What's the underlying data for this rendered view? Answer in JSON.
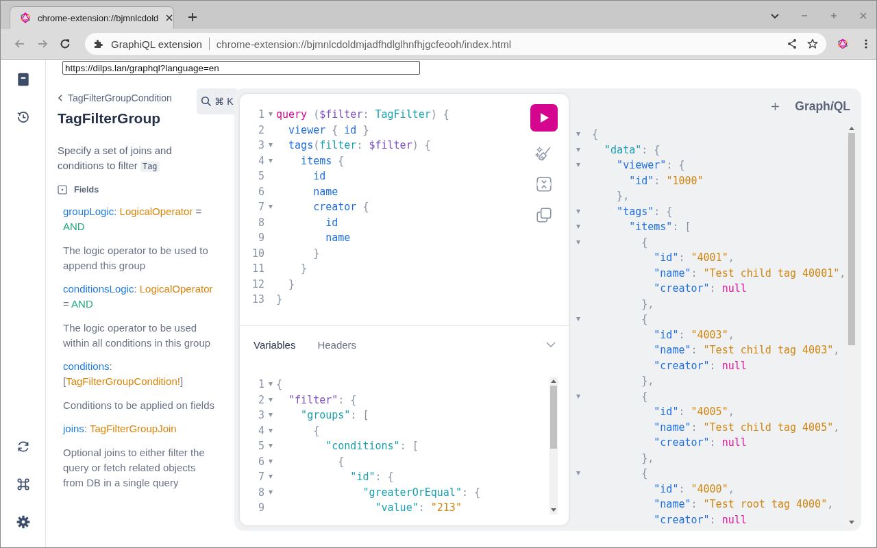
{
  "browser": {
    "tab": {
      "title": "chrome-extension://bjmnlcdold",
      "selected": true
    },
    "omnibox": {
      "site": "GraphiQL extension",
      "url": "chrome-extension://bjmnlcdoldmjadfhdlglhnfhjgcfeooh/index.html"
    }
  },
  "endpoint": {
    "value": "https://dilps.lan/graphql?language=en"
  },
  "search_button": {
    "label": "⌘ K"
  },
  "docs": {
    "breadcrumb": "TagFilterGroupCondition",
    "title": "TagFilterGroup",
    "description": "Specify a set of joins and conditions to filter",
    "description_code": "Tag",
    "section": "Fields",
    "fields": [
      {
        "signature": [
          {
            "text": "groupLogic",
            "kind": "name"
          },
          {
            "text": ": ",
            "kind": "punc"
          },
          {
            "text": "LogicalOperator",
            "kind": "type"
          },
          {
            "text": " = ",
            "kind": "punc"
          },
          {
            "text": "AND",
            "kind": "default"
          }
        ],
        "description": "The logic operator to be used to append this group"
      },
      {
        "signature": [
          {
            "text": "conditionsLogic",
            "kind": "name"
          },
          {
            "text": ": ",
            "kind": "punc"
          },
          {
            "text": "LogicalOperator",
            "kind": "type"
          },
          {
            "text": " = ",
            "kind": "punc"
          },
          {
            "text": "AND",
            "kind": "default"
          }
        ],
        "description": "The logic operator to be used within all conditions in this group"
      },
      {
        "signature": [
          {
            "text": "conditions",
            "kind": "name"
          },
          {
            "text": ": [",
            "kind": "punc"
          },
          {
            "text": "TagFilterGroupCondition!",
            "kind": "type"
          },
          {
            "text": "]",
            "kind": "punc"
          }
        ],
        "description": "Conditions to be applied on fields"
      },
      {
        "signature": [
          {
            "text": "joins",
            "kind": "name"
          },
          {
            "text": ": ",
            "kind": "punc"
          },
          {
            "text": "TagFilterGroupJoin",
            "kind": "type"
          }
        ],
        "description": "Optional joins to either filter the query or fetch related objects from DB in a single query"
      }
    ]
  },
  "editor": {
    "lines": [
      {
        "n": "1",
        "fold": true,
        "tokens": [
          {
            "text": "query",
            "kind": "kw"
          },
          {
            "text": " (",
            "kind": "punc"
          },
          {
            "text": "$filter",
            "kind": "var"
          },
          {
            "text": ": ",
            "kind": "punc"
          },
          {
            "text": "TagFilter",
            "kind": "type"
          },
          {
            "text": ") {",
            "kind": "punc"
          }
        ]
      },
      {
        "n": "2",
        "fold": false,
        "tokens": [
          {
            "text": "  viewer",
            "kind": "field"
          },
          {
            "text": " { ",
            "kind": "punc"
          },
          {
            "text": "id",
            "kind": "field"
          },
          {
            "text": " }",
            "kind": "punc"
          }
        ]
      },
      {
        "n": "3",
        "fold": true,
        "tokens": [
          {
            "text": "  tags",
            "kind": "field"
          },
          {
            "text": "(",
            "kind": "punc"
          },
          {
            "text": "filter",
            "kind": "type"
          },
          {
            "text": ": ",
            "kind": "punc"
          },
          {
            "text": "$filter",
            "kind": "var"
          },
          {
            "text": ") {",
            "kind": "punc"
          }
        ]
      },
      {
        "n": "4",
        "fold": true,
        "tokens": [
          {
            "text": "    items",
            "kind": "field"
          },
          {
            "text": " {",
            "kind": "punc"
          }
        ]
      },
      {
        "n": "5",
        "fold": false,
        "tokens": [
          {
            "text": "      id",
            "kind": "field"
          }
        ]
      },
      {
        "n": "6",
        "fold": false,
        "tokens": [
          {
            "text": "      name",
            "kind": "field"
          }
        ]
      },
      {
        "n": "7",
        "fold": true,
        "tokens": [
          {
            "text": "      creator",
            "kind": "field"
          },
          {
            "text": " {",
            "kind": "punc"
          }
        ]
      },
      {
        "n": "8",
        "fold": false,
        "tokens": [
          {
            "text": "        id",
            "kind": "field"
          }
        ]
      },
      {
        "n": "9",
        "fold": false,
        "tokens": [
          {
            "text": "        name",
            "kind": "field"
          }
        ]
      },
      {
        "n": "10",
        "fold": false,
        "tokens": [
          {
            "text": "      }",
            "kind": "punc"
          }
        ]
      },
      {
        "n": "11",
        "fold": false,
        "tokens": [
          {
            "text": "    }",
            "kind": "punc"
          }
        ]
      },
      {
        "n": "12",
        "fold": false,
        "tokens": [
          {
            "text": "  }",
            "kind": "punc"
          }
        ]
      },
      {
        "n": "13",
        "fold": false,
        "tokens": [
          {
            "text": "}",
            "kind": "punc"
          }
        ]
      }
    ]
  },
  "tool_tabs": [
    {
      "label": "Variables",
      "selected": true
    },
    {
      "label": "Headers",
      "selected": false
    }
  ],
  "variables": {
    "lines": [
      {
        "n": "1",
        "fold": true,
        "tokens": [
          {
            "text": "{",
            "kind": "punc"
          }
        ]
      },
      {
        "n": "2",
        "fold": true,
        "tokens": [
          {
            "text": "  \"filter\"",
            "kind": "var"
          },
          {
            "text": ": {",
            "kind": "punc"
          }
        ]
      },
      {
        "n": "3",
        "fold": true,
        "tokens": [
          {
            "text": "    \"groups\"",
            "kind": "type"
          },
          {
            "text": ": [",
            "kind": "punc"
          }
        ]
      },
      {
        "n": "4",
        "fold": true,
        "tokens": [
          {
            "text": "      {",
            "kind": "punc"
          }
        ]
      },
      {
        "n": "5",
        "fold": true,
        "tokens": [
          {
            "text": "        \"conditions\"",
            "kind": "type"
          },
          {
            "text": ": [",
            "kind": "punc"
          }
        ]
      },
      {
        "n": "6",
        "fold": true,
        "tokens": [
          {
            "text": "          {",
            "kind": "punc"
          }
        ]
      },
      {
        "n": "7",
        "fold": true,
        "tokens": [
          {
            "text": "            \"id\"",
            "kind": "type"
          },
          {
            "text": ": {",
            "kind": "punc"
          }
        ]
      },
      {
        "n": "8",
        "fold": true,
        "tokens": [
          {
            "text": "              \"greaterOrEqual\"",
            "kind": "type"
          },
          {
            "text": ": {",
            "kind": "punc"
          }
        ]
      },
      {
        "n": "9",
        "fold": false,
        "tokens": [
          {
            "text": "                \"value\"",
            "kind": "type"
          },
          {
            "text": ": ",
            "kind": "punc"
          },
          {
            "text": "\"213\"",
            "kind": "str"
          }
        ]
      }
    ]
  },
  "logo": {
    "before": "Graph",
    "italic": "i",
    "after": "QL"
  },
  "result": {
    "lines": [
      {
        "fold": true,
        "tokens": [
          {
            "text": "{",
            "kind": "punc"
          }
        ]
      },
      {
        "fold": true,
        "tokens": [
          {
            "text": "  \"data\"",
            "kind": "type"
          },
          {
            "text": ": {",
            "kind": "punc"
          }
        ]
      },
      {
        "fold": true,
        "tokens": [
          {
            "text": "    \"viewer\"",
            "kind": "field"
          },
          {
            "text": ": {",
            "kind": "punc"
          }
        ]
      },
      {
        "fold": false,
        "tokens": [
          {
            "text": "      \"id\"",
            "kind": "field"
          },
          {
            "text": ": ",
            "kind": "punc"
          },
          {
            "text": "\"1000\"",
            "kind": "str"
          }
        ]
      },
      {
        "fold": false,
        "tokens": [
          {
            "text": "    },",
            "kind": "punc"
          }
        ]
      },
      {
        "fold": true,
        "tokens": [
          {
            "text": "    \"tags\"",
            "kind": "field"
          },
          {
            "text": ": {",
            "kind": "punc"
          }
        ]
      },
      {
        "fold": true,
        "tokens": [
          {
            "text": "      \"items\"",
            "kind": "field"
          },
          {
            "text": ": [",
            "kind": "punc"
          }
        ]
      },
      {
        "fold": true,
        "tokens": [
          {
            "text": "        {",
            "kind": "punc"
          }
        ]
      },
      {
        "fold": false,
        "tokens": [
          {
            "text": "          \"id\"",
            "kind": "field"
          },
          {
            "text": ": ",
            "kind": "punc"
          },
          {
            "text": "\"4001\"",
            "kind": "str"
          },
          {
            "text": ",",
            "kind": "punc"
          }
        ]
      },
      {
        "fold": false,
        "tokens": [
          {
            "text": "          \"name\"",
            "kind": "field"
          },
          {
            "text": ": ",
            "kind": "punc"
          },
          {
            "text": "\"Test child tag 40001\"",
            "kind": "str"
          },
          {
            "text": ",",
            "kind": "punc"
          }
        ]
      },
      {
        "fold": false,
        "tokens": [
          {
            "text": "          \"creator\"",
            "kind": "field"
          },
          {
            "text": ": ",
            "kind": "punc"
          },
          {
            "text": "null",
            "kind": "null"
          }
        ]
      },
      {
        "fold": false,
        "tokens": [
          {
            "text": "        },",
            "kind": "punc"
          }
        ]
      },
      {
        "fold": true,
        "tokens": [
          {
            "text": "        {",
            "kind": "punc"
          }
        ]
      },
      {
        "fold": false,
        "tokens": [
          {
            "text": "          \"id\"",
            "kind": "field"
          },
          {
            "text": ": ",
            "kind": "punc"
          },
          {
            "text": "\"4003\"",
            "kind": "str"
          },
          {
            "text": ",",
            "kind": "punc"
          }
        ]
      },
      {
        "fold": false,
        "tokens": [
          {
            "text": "          \"name\"",
            "kind": "field"
          },
          {
            "text": ": ",
            "kind": "punc"
          },
          {
            "text": "\"Test child tag 4003\"",
            "kind": "str"
          },
          {
            "text": ",",
            "kind": "punc"
          }
        ]
      },
      {
        "fold": false,
        "tokens": [
          {
            "text": "          \"creator\"",
            "kind": "field"
          },
          {
            "text": ": ",
            "kind": "punc"
          },
          {
            "text": "null",
            "kind": "null"
          }
        ]
      },
      {
        "fold": false,
        "tokens": [
          {
            "text": "        },",
            "kind": "punc"
          }
        ]
      },
      {
        "fold": true,
        "tokens": [
          {
            "text": "        {",
            "kind": "punc"
          }
        ]
      },
      {
        "fold": false,
        "tokens": [
          {
            "text": "          \"id\"",
            "kind": "field"
          },
          {
            "text": ": ",
            "kind": "punc"
          },
          {
            "text": "\"4005\"",
            "kind": "str"
          },
          {
            "text": ",",
            "kind": "punc"
          }
        ]
      },
      {
        "fold": false,
        "tokens": [
          {
            "text": "          \"name\"",
            "kind": "field"
          },
          {
            "text": ": ",
            "kind": "punc"
          },
          {
            "text": "\"Test child tag 4005\"",
            "kind": "str"
          },
          {
            "text": ",",
            "kind": "punc"
          }
        ]
      },
      {
        "fold": false,
        "tokens": [
          {
            "text": "          \"creator\"",
            "kind": "field"
          },
          {
            "text": ": ",
            "kind": "punc"
          },
          {
            "text": "null",
            "kind": "null"
          }
        ]
      },
      {
        "fold": false,
        "tokens": [
          {
            "text": "        },",
            "kind": "punc"
          }
        ]
      },
      {
        "fold": true,
        "tokens": [
          {
            "text": "        {",
            "kind": "punc"
          }
        ]
      },
      {
        "fold": false,
        "tokens": [
          {
            "text": "          \"id\"",
            "kind": "field"
          },
          {
            "text": ": ",
            "kind": "punc"
          },
          {
            "text": "\"4000\"",
            "kind": "str"
          },
          {
            "text": ",",
            "kind": "punc"
          }
        ]
      },
      {
        "fold": false,
        "tokens": [
          {
            "text": "          \"name\"",
            "kind": "field"
          },
          {
            "text": ": ",
            "kind": "punc"
          },
          {
            "text": "\"Test root tag 4000\"",
            "kind": "str"
          },
          {
            "text": ",",
            "kind": "punc"
          }
        ]
      },
      {
        "fold": false,
        "tokens": [
          {
            "text": "          \"creator\"",
            "kind": "field"
          },
          {
            "text": ": ",
            "kind": "punc"
          },
          {
            "text": "null",
            "kind": "null"
          }
        ]
      }
    ]
  }
}
